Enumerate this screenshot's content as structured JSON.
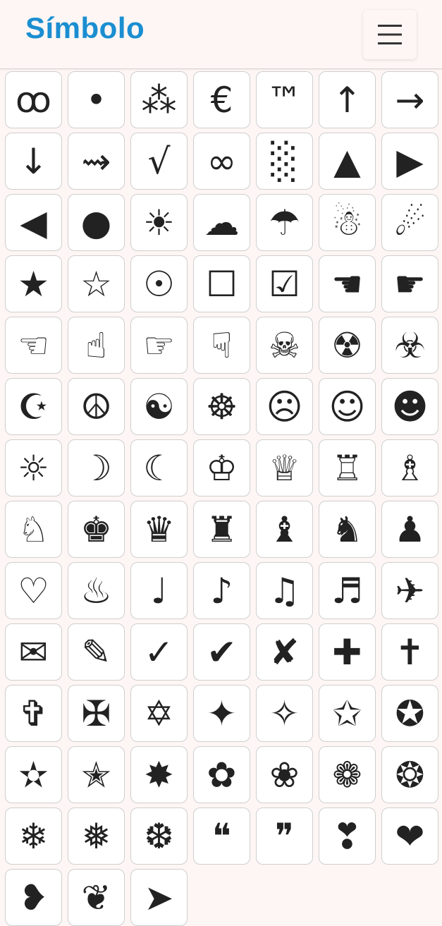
{
  "header": {
    "title": "Símbolo",
    "menu_icon": "hamburger-menu-icon"
  },
  "symbols": [
    {
      "char": "ꝏ",
      "name": "curly-glyph"
    },
    {
      "char": "•",
      "name": "bullet"
    },
    {
      "char": "⁂",
      "name": "asterism"
    },
    {
      "char": "€",
      "name": "euro-sign"
    },
    {
      "char": "™",
      "name": "trademark"
    },
    {
      "char": "↑",
      "name": "up-arrow"
    },
    {
      "char": "→",
      "name": "right-arrow"
    },
    {
      "char": "↓",
      "name": "down-arrow"
    },
    {
      "char": "⇝",
      "name": "squiggly-arrow"
    },
    {
      "char": "√",
      "name": "square-root"
    },
    {
      "char": "∞",
      "name": "infinity"
    },
    {
      "char": "░",
      "name": "dotted-shade"
    },
    {
      "char": "▲",
      "name": "up-triangle"
    },
    {
      "char": "▶",
      "name": "right-triangle"
    },
    {
      "char": "◀",
      "name": "left-triangle"
    },
    {
      "char": "●",
      "name": "black-circle"
    },
    {
      "char": "☀",
      "name": "sun"
    },
    {
      "char": "☁",
      "name": "cloud"
    },
    {
      "char": "☂",
      "name": "umbrella"
    },
    {
      "char": "☃",
      "name": "snowman"
    },
    {
      "char": "☄",
      "name": "comet"
    },
    {
      "char": "★",
      "name": "black-star"
    },
    {
      "char": "☆",
      "name": "white-star"
    },
    {
      "char": "☉",
      "name": "sun-dot"
    },
    {
      "char": "☐",
      "name": "ballot-box"
    },
    {
      "char": "☑",
      "name": "ballot-box-check"
    },
    {
      "char": "☚",
      "name": "black-left-hand"
    },
    {
      "char": "☛",
      "name": "black-right-hand"
    },
    {
      "char": "☜",
      "name": "white-left-hand"
    },
    {
      "char": "☝",
      "name": "white-up-hand"
    },
    {
      "char": "☞",
      "name": "white-right-hand"
    },
    {
      "char": "☟",
      "name": "white-down-hand"
    },
    {
      "char": "☠",
      "name": "skull-crossbones"
    },
    {
      "char": "☢",
      "name": "radioactive"
    },
    {
      "char": "☣",
      "name": "biohazard"
    },
    {
      "char": "☪",
      "name": "star-crescent"
    },
    {
      "char": "☮",
      "name": "peace"
    },
    {
      "char": "☯",
      "name": "yin-yang"
    },
    {
      "char": "☸",
      "name": "dharma-wheel"
    },
    {
      "char": "☹",
      "name": "frowning-face"
    },
    {
      "char": "☺",
      "name": "smiling-face"
    },
    {
      "char": "☻",
      "name": "black-smiling-face"
    },
    {
      "char": "☼",
      "name": "white-sun"
    },
    {
      "char": "☽",
      "name": "first-quarter-moon"
    },
    {
      "char": "☾",
      "name": "last-quarter-moon"
    },
    {
      "char": "♔",
      "name": "white-king"
    },
    {
      "char": "♕",
      "name": "white-queen"
    },
    {
      "char": "♖",
      "name": "white-rook"
    },
    {
      "char": "♗",
      "name": "white-bishop"
    },
    {
      "char": "♘",
      "name": "white-knight"
    },
    {
      "char": "♚",
      "name": "black-king"
    },
    {
      "char": "♛",
      "name": "black-queen"
    },
    {
      "char": "♜",
      "name": "black-rook"
    },
    {
      "char": "♝",
      "name": "black-bishop"
    },
    {
      "char": "♞",
      "name": "black-knight"
    },
    {
      "char": "♟",
      "name": "black-pawn"
    },
    {
      "char": "♡",
      "name": "white-heart"
    },
    {
      "char": "♨",
      "name": "hot-springs"
    },
    {
      "char": "♩",
      "name": "quarter-note"
    },
    {
      "char": "♪",
      "name": "eighth-note"
    },
    {
      "char": "♫",
      "name": "beamed-eighth-notes"
    },
    {
      "char": "♬",
      "name": "beamed-sixteenth-notes"
    },
    {
      "char": "✈",
      "name": "airplane"
    },
    {
      "char": "✉",
      "name": "envelope"
    },
    {
      "char": "✎",
      "name": "pencil"
    },
    {
      "char": "✓",
      "name": "check-mark"
    },
    {
      "char": "✔",
      "name": "heavy-check-mark"
    },
    {
      "char": "✘",
      "name": "ballot-x"
    },
    {
      "char": "✚",
      "name": "heavy-cross"
    },
    {
      "char": "✝",
      "name": "latin-cross"
    },
    {
      "char": "✞",
      "name": "shadowed-cross"
    },
    {
      "char": "✠",
      "name": "maltese-cross"
    },
    {
      "char": "✡",
      "name": "star-of-david"
    },
    {
      "char": "✦",
      "name": "four-pointed-star"
    },
    {
      "char": "✧",
      "name": "white-four-pointed-star"
    },
    {
      "char": "✩",
      "name": "outlined-star"
    },
    {
      "char": "✪",
      "name": "circled-star"
    },
    {
      "char": "✫",
      "name": "open-center-star"
    },
    {
      "char": "✭",
      "name": "outlined-black-star"
    },
    {
      "char": "✸",
      "name": "eight-pointed-star"
    },
    {
      "char": "✿",
      "name": "black-florette"
    },
    {
      "char": "❀",
      "name": "white-florette"
    },
    {
      "char": "❁",
      "name": "eight-petalled-florette"
    },
    {
      "char": "❂",
      "name": "circled-sun"
    },
    {
      "char": "❄",
      "name": "snowflake"
    },
    {
      "char": "❅",
      "name": "tight-snowflake"
    },
    {
      "char": "❆",
      "name": "heavy-snowflake"
    },
    {
      "char": "❝",
      "name": "open-quote"
    },
    {
      "char": "❞",
      "name": "close-quote"
    },
    {
      "char": "❣",
      "name": "heart-exclamation"
    },
    {
      "char": "❤",
      "name": "heavy-heart"
    },
    {
      "char": "❥",
      "name": "rotated-heart"
    },
    {
      "char": "❦",
      "name": "floral-heart"
    },
    {
      "char": "➤",
      "name": "arrowhead"
    }
  ]
}
